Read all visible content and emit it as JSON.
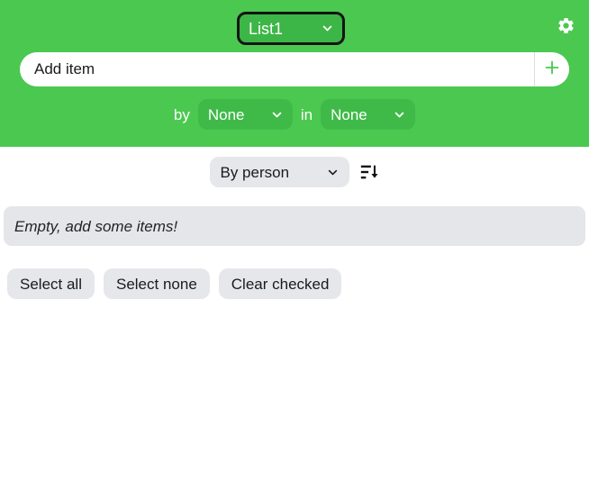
{
  "theme": {
    "header_green": "#4bc850",
    "select_green": "#3fba49",
    "grey_chip": "#e6e7eb",
    "empty_bar_grey": "#e4e6ea",
    "text_dark": "#1b1b1f",
    "text_light": "#ffffff"
  },
  "header": {
    "list_selector": {
      "value": "List1",
      "caret_icon": "chevron-down-icon",
      "focused": true
    },
    "settings_icon": "gear-icon",
    "add_item": {
      "value": "",
      "placeholder": "Add item",
      "add_button_icon": "plus-icon",
      "add_button_label": "+"
    },
    "assign": {
      "by_label": "by",
      "by_value": "None",
      "in_label": "in",
      "in_value": "None",
      "caret_icon": "chevron-down-icon"
    }
  },
  "main": {
    "sort": {
      "group_by_value": "By person",
      "caret_icon": "chevron-down-icon",
      "direction_icon": "sort-descending-icon"
    },
    "empty_message": "Empty, add some items!",
    "actions": [
      {
        "label": "Select all",
        "name": "select-all-button"
      },
      {
        "label": "Select none",
        "name": "select-none-button"
      },
      {
        "label": "Clear checked",
        "name": "clear-checked-button"
      }
    ]
  }
}
